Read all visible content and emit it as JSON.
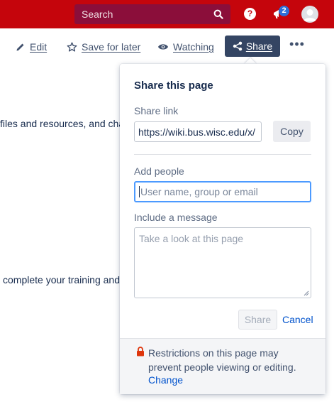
{
  "header": {
    "search_placeholder": "Search",
    "help_glyph": "?",
    "notification_count": "2",
    "brand_color": "#c5050c"
  },
  "toolbar": {
    "edit_label": "Edit",
    "save_label": "Save for later",
    "watch_label": "Watching",
    "share_label": "Share",
    "more_label": "•••"
  },
  "background": {
    "line1": "files and resources, and cha",
    "line2": "complete your training and"
  },
  "share_popup": {
    "title": "Share this page",
    "share_link_label": "Share link",
    "share_link_value": "https://wiki.bus.wisc.edu/x/",
    "copy_label": "Copy",
    "add_people_label": "Add people",
    "add_people_placeholder": "User name, group or email",
    "message_label": "Include a message",
    "message_placeholder": "Take a look at this page",
    "share_button_label": "Share",
    "cancel_label": "Cancel",
    "restriction_text": "Restrictions on this page may prevent people viewing or editing.",
    "change_label": "Change"
  },
  "icons": {
    "search": "search-icon",
    "help": "help-icon",
    "notification": "megaphone-icon",
    "avatar": "user-avatar-icon",
    "edit": "pencil-icon",
    "save": "star-icon",
    "watch": "eye-icon",
    "share": "share-icon",
    "lock": "lock-icon"
  }
}
